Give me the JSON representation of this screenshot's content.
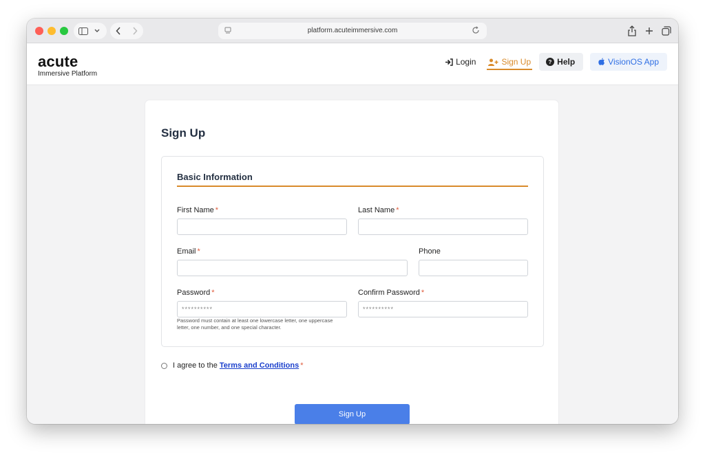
{
  "browser": {
    "url": "platform.acuteimmersive.com"
  },
  "header": {
    "logo_title": "acute",
    "logo_subtitle": "Immersive Platform",
    "nav": {
      "login": "Login",
      "signup": "Sign Up",
      "help": "Help",
      "visionos": "VisionOS App"
    },
    "colors": {
      "accent": "#d98a2a",
      "link_blue": "#2f6fe4"
    }
  },
  "form": {
    "title": "Sign Up",
    "section_title": "Basic Information",
    "required_mark": "*",
    "fields": {
      "first_name": {
        "label": "First Name",
        "value": "",
        "placeholder": ""
      },
      "last_name": {
        "label": "Last Name",
        "value": "",
        "placeholder": ""
      },
      "email": {
        "label": "Email",
        "value": "",
        "placeholder": ""
      },
      "phone": {
        "label": "Phone",
        "value": "",
        "placeholder": ""
      },
      "password": {
        "label": "Password",
        "value": "",
        "placeholder": "**********"
      },
      "confirm_password": {
        "label": "Confirm Password",
        "value": "",
        "placeholder": "**********"
      }
    },
    "password_hint": "Password must contain at least one lowercase letter, one uppercase letter, one number, and one special character.",
    "agree_prefix": "I agree to the",
    "terms_link": "Terms and Conditions",
    "submit_label": "Sign Up",
    "colors": {
      "submit": "#4a7fe8",
      "required": "#e05a3a"
    }
  }
}
